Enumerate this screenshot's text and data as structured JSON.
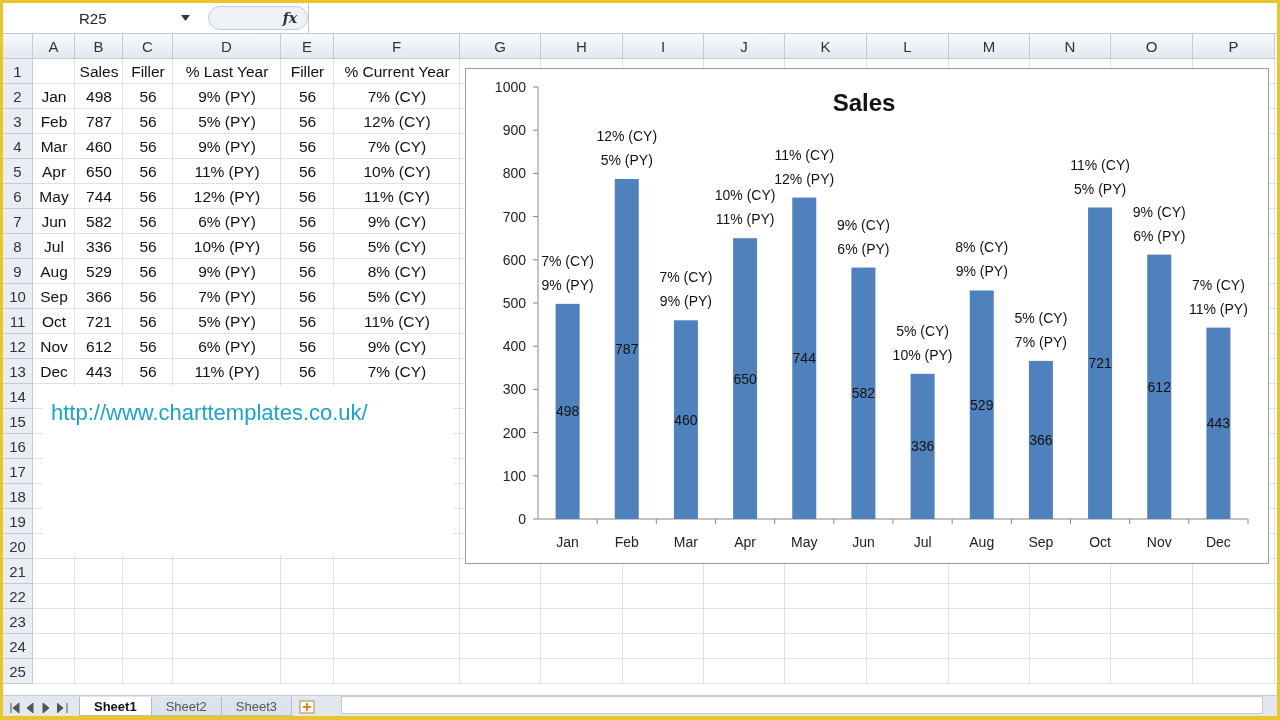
{
  "formula_bar": {
    "name_box": "R25",
    "function_label": "fx"
  },
  "sheet": {
    "columns": [
      "A",
      "B",
      "C",
      "D",
      "E",
      "F",
      "G",
      "H",
      "I",
      "J",
      "K",
      "L",
      "M",
      "N",
      "O",
      "P"
    ],
    "header_row": {
      "number": "1",
      "cells": [
        "Sales",
        "Filler",
        "% Last Year",
        "Filler",
        "% Current Year"
      ]
    },
    "rows": [
      {
        "number": "2",
        "cells": [
          "Jan",
          "498",
          "56",
          "9% (PY)",
          "56",
          "7% (CY)"
        ]
      },
      {
        "number": "3",
        "cells": [
          "Feb",
          "787",
          "56",
          "5% (PY)",
          "56",
          "12% (CY)"
        ]
      },
      {
        "number": "4",
        "cells": [
          "Mar",
          "460",
          "56",
          "9% (PY)",
          "56",
          "7% (CY)"
        ]
      },
      {
        "number": "5",
        "cells": [
          "Apr",
          "650",
          "56",
          "11% (PY)",
          "56",
          "10% (CY)"
        ]
      },
      {
        "number": "6",
        "cells": [
          "May",
          "744",
          "56",
          "12% (PY)",
          "56",
          "11% (CY)"
        ]
      },
      {
        "number": "7",
        "cells": [
          "Jun",
          "582",
          "56",
          "6% (PY)",
          "56",
          "9% (CY)"
        ]
      },
      {
        "number": "8",
        "cells": [
          "Jul",
          "336",
          "56",
          "10% (PY)",
          "56",
          "5% (CY)"
        ]
      },
      {
        "number": "9",
        "cells": [
          "Aug",
          "529",
          "56",
          "9% (PY)",
          "56",
          "8% (CY)"
        ]
      },
      {
        "number": "10",
        "cells": [
          "Sep",
          "366",
          "56",
          "7% (PY)",
          "56",
          "5% (CY)"
        ]
      },
      {
        "number": "11",
        "cells": [
          "Oct",
          "721",
          "56",
          "5% (PY)",
          "56",
          "11% (CY)"
        ]
      },
      {
        "number": "12",
        "cells": [
          "Nov",
          "612",
          "56",
          "6% (PY)",
          "56",
          "9% (CY)"
        ]
      },
      {
        "number": "13",
        "cells": [
          "Dec",
          "443",
          "56",
          "11% (PY)",
          "56",
          "7% (CY)"
        ]
      },
      {
        "number": "14"
      },
      {
        "number": "15"
      },
      {
        "number": "16"
      },
      {
        "number": "17"
      },
      {
        "number": "18"
      },
      {
        "number": "19"
      },
      {
        "number": "20"
      },
      {
        "number": "21"
      },
      {
        "number": "22"
      },
      {
        "number": "23"
      },
      {
        "number": "24"
      },
      {
        "number": "25"
      }
    ]
  },
  "link_box": {
    "text": "http://www.charttemplates.co.uk/"
  },
  "chart": {
    "chart_data": {
      "type": "bar",
      "title": "Sales",
      "categories": [
        "Jan",
        "Feb",
        "Mar",
        "Apr",
        "May",
        "Jun",
        "Jul",
        "Aug",
        "Sep",
        "Oct",
        "Nov",
        "Dec"
      ],
      "series": [
        {
          "color": "#4f81bd",
          "values": [
            498,
            787,
            460,
            650,
            744,
            582,
            336,
            529,
            366,
            721,
            612,
            443
          ]
        }
      ],
      "ylim": [
        0,
        1000
      ],
      "yticks": [
        0,
        100,
        200,
        300,
        400,
        500,
        600,
        700,
        800,
        900,
        1000
      ],
      "value_labels": [
        "498",
        "787",
        "460",
        "650",
        "744",
        "582",
        "336",
        "529",
        "366",
        "721",
        "612",
        "443"
      ],
      "annotations": [
        "7% (CY)",
        "9% (PY)",
        "12% (CY)",
        "5% (PY)",
        "7% (CY)",
        "9% (PY)",
        "10% (CY)",
        "11% (PY)",
        "11% (CY)",
        "12% (PY)",
        "9% (CY)",
        "6% (PY)",
        "5% (CY)",
        "10% (PY)",
        "8% (CY)",
        "9% (PY)",
        "5% (CY)",
        "7% (PY)",
        "11% (CY)",
        "5% (PY)",
        "9% (CY)",
        "6% (PY)",
        "7% (CY)",
        "11% (PY)"
      ]
    }
  },
  "sheet_tabs": [
    {
      "label": "Sheet1",
      "selected": true
    },
    {
      "label": "Sheet2",
      "selected": false
    },
    {
      "label": "Sheet3",
      "selected": false
    }
  ]
}
